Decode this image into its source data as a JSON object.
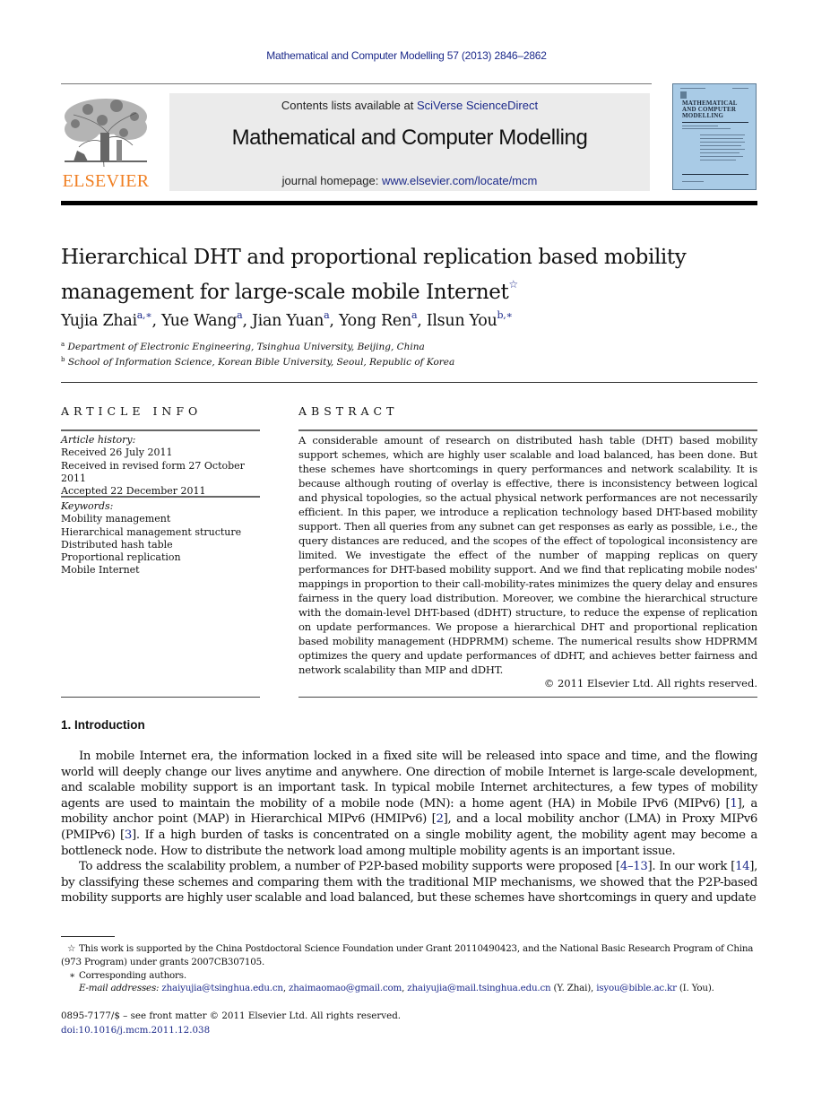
{
  "running_head": "Mathematical and Computer Modelling 57 (2013) 2846–2862",
  "masthead": {
    "publisher": "ELSEVIER",
    "contents_prefix": "Contents lists available at ",
    "contents_link": "SciVerse ScienceDirect",
    "journal_title": "Mathematical and Computer Modelling",
    "homepage_prefix": "journal homepage: ",
    "homepage_link": "www.elsevier.com/locate/mcm",
    "cover_title_lines": [
      "MATHEMATICAL",
      "AND COMPUTER",
      "MODELLING"
    ]
  },
  "colors": {
    "link": "#1c2a8a",
    "publisher_orange": "#f07f22",
    "band_gray": "#ebebeb",
    "cover_blue": "#a9cbe6"
  },
  "article": {
    "title_line1": "Hierarchical DHT and proportional replication based mobility",
    "title_line2": "management for large-scale mobile Internet",
    "title_mark": "☆",
    "authors": [
      {
        "name": "Yujia Zhai",
        "sup": "a,∗"
      },
      {
        "name": "Yue Wang",
        "sup": "a"
      },
      {
        "name": "Jian Yuan",
        "sup": "a"
      },
      {
        "name": "Yong Ren",
        "sup": "a"
      },
      {
        "name": "Ilsun You",
        "sup": "b,∗"
      }
    ],
    "author_separator": ", ",
    "affiliations": [
      {
        "mark": "a",
        "text": "Department of Electronic Engineering, Tsinghua University, Beijing, China"
      },
      {
        "mark": "b",
        "text": "School of Information Science, Korean Bible University, Seoul, Republic of Korea"
      }
    ]
  },
  "article_info": {
    "heading": "ARTICLE INFO",
    "history_label": "Article history:",
    "history": [
      "Received 26 July 2011",
      "Received in revised form 27 October 2011",
      "Accepted 22 December 2011"
    ],
    "keywords_label": "Keywords:",
    "keywords": [
      "Mobility management",
      "Hierarchical management structure",
      "Distributed hash table",
      "Proportional replication",
      "Mobile Internet"
    ]
  },
  "abstract": {
    "heading": "ABSTRACT",
    "text": "A considerable amount of research on distributed hash table (DHT) based mobility support schemes, which are highly user scalable and load balanced, has been done. But these schemes have shortcomings in query performances and network scalability. It is because although routing of overlay is effective, there is inconsistency between logical and physical topologies, so the actual physical network performances are not necessarily efficient. In this paper, we introduce a replication technology based DHT-based mobility support. Then all queries from any subnet can get responses as early as possible, i.e., the query distances are reduced, and the scopes of the effect of topological inconsistency are limited. We investigate the effect of the number of mapping replicas on query performances for DHT-based mobility support. And we find that replicating mobile nodes' mappings in proportion to their call-mobility-rates minimizes the query delay and ensures fairness in the query load distribution. Moreover, we combine the hierarchical structure with the domain-level DHT-based (dDHT) structure, to reduce the expense of replication on update performances. We propose a hierarchical DHT and proportional replication based mobility management (HDPRMM) scheme. The numerical results show HDPRMM optimizes the query and update performances of dDHT, and achieves better fairness and network scalability than MIP and dDHT.",
    "copyright": "© 2011 Elsevier Ltd. All rights reserved."
  },
  "introduction": {
    "heading": "1.  Introduction",
    "p1": [
      {
        "t": "In mobile Internet era, the information locked in a fixed site will be released into space and time, and the flowing world will deeply change our lives anytime and anywhere. One direction of mobile Internet is large-scale development, and scalable mobility support is an important task. In typical mobile Internet architectures, a few types of mobility agents are used to maintain the mobility of a mobile node (MN): a home agent (HA) in Mobile IPv6 (MIPv6) ["
      },
      {
        "ref": "1"
      },
      {
        "t": "], a mobility anchor point (MAP) in Hierarchical MIPv6 (HMIPv6) ["
      },
      {
        "ref": "2"
      },
      {
        "t": "], and a local mobility anchor (LMA) in Proxy MIPv6 (PMIPv6) ["
      },
      {
        "ref": "3"
      },
      {
        "t": "]. If a high burden of tasks is concentrated on a single mobility agent, the mobility agent may become a bottleneck node. How to distribute the network load among multiple mobility agents is an important issue."
      }
    ],
    "p2": [
      {
        "t": "To address the scalability problem, a number of P2P-based mobility supports were proposed ["
      },
      {
        "ref": "4–13"
      },
      {
        "t": "]. In our work ["
      },
      {
        "ref": "14"
      },
      {
        "t": "], by classifying these schemes and comparing them with the traditional MIP mechanisms, we showed that the P2P-based mobility supports are highly user scalable and load balanced, but these schemes have shortcomings in query and update"
      }
    ]
  },
  "footnotes": {
    "funding_mark": "☆",
    "funding": "This work is supported by the China Postdoctoral Science Foundation under Grant 20110490423, and the National Basic Research Program of China (973 Program) under grants 2007CB307105.",
    "corresponding_mark": "∗",
    "corresponding": "Corresponding authors.",
    "email_label": "E-mail addresses:",
    "emails": [
      {
        "address": "zhaiyujia@tsinghua.edu.cn",
        "after": ", "
      },
      {
        "address": "zhaimaomao@gmail.com",
        "after": ", "
      },
      {
        "address": "zhaiyujia@mail.tsinghua.edu.cn",
        "after": " (Y. Zhai), "
      },
      {
        "address": "isyou@bible.ac.kr",
        "after": " (I. You)."
      }
    ]
  },
  "front_matter": {
    "issn_line": "0895-7177/$ – see front matter © 2011 Elsevier Ltd. All rights reserved.",
    "doi": "doi:10.1016/j.mcm.2011.12.038"
  }
}
